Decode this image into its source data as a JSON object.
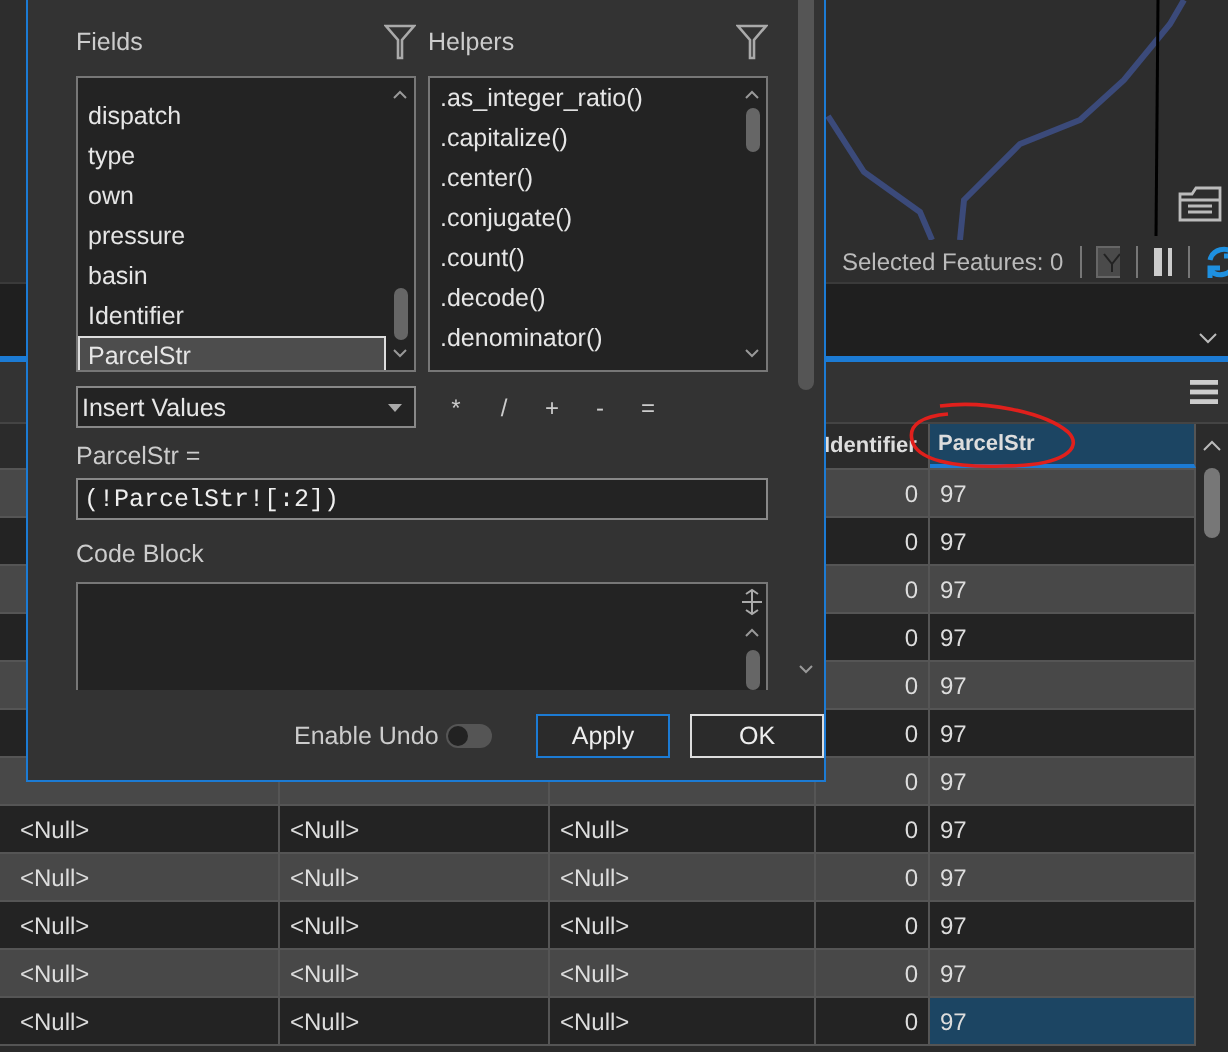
{
  "map": {
    "status_text": "Selected Features: 0"
  },
  "table": {
    "columns": [
      null,
      null,
      null,
      {
        "label": "Identifier",
        "selected": false
      },
      {
        "label": "ParcelStr",
        "selected": true
      }
    ],
    "rows": [
      {
        "cells": [
          null,
          null,
          null,
          "0",
          "97"
        ],
        "selected": false
      },
      {
        "cells": [
          null,
          null,
          null,
          "0",
          "97"
        ],
        "selected": false
      },
      {
        "cells": [
          null,
          null,
          null,
          "0",
          "97"
        ],
        "selected": false
      },
      {
        "cells": [
          null,
          null,
          null,
          "0",
          "97"
        ],
        "selected": false
      },
      {
        "cells": [
          null,
          null,
          null,
          "0",
          "97"
        ],
        "selected": false
      },
      {
        "cells": [
          null,
          null,
          null,
          "0",
          "97"
        ],
        "selected": false
      },
      {
        "cells": [
          null,
          null,
          null,
          "0",
          "97"
        ],
        "selected": false
      },
      {
        "cells": [
          "<Null>",
          "<Null>",
          "<Null>",
          "0",
          "97"
        ],
        "selected": false
      },
      {
        "cells": [
          "<Null>",
          "<Null>",
          "<Null>",
          "0",
          "97"
        ],
        "selected": false
      },
      {
        "cells": [
          "<Null>",
          "<Null>",
          "<Null>",
          "0",
          "97"
        ],
        "selected": false
      },
      {
        "cells": [
          "<Null>",
          "<Null>",
          "<Null>",
          "0",
          "97"
        ],
        "selected": false
      },
      {
        "cells": [
          "<Null>",
          "<Null>",
          "<Null>",
          "0",
          "97"
        ],
        "selected": true
      }
    ]
  },
  "dialog": {
    "fields_label": "Fields",
    "helpers_label": "Helpers",
    "fields": [
      {
        "label": "dispatch",
        "selected": false
      },
      {
        "label": "type",
        "selected": false
      },
      {
        "label": "own",
        "selected": false
      },
      {
        "label": "pressure",
        "selected": false
      },
      {
        "label": "basin",
        "selected": false
      },
      {
        "label": "Identifier",
        "selected": false
      },
      {
        "label": "ParcelStr",
        "selected": true
      }
    ],
    "helpers": [
      ".as_integer_ratio()",
      ".capitalize()",
      ".center()",
      ".conjugate()",
      ".count()",
      ".decode()",
      ".denominator()"
    ],
    "insert_dropdown": "Insert Values",
    "operators": [
      "*",
      "/",
      "+",
      "-",
      "="
    ],
    "expression_label": "ParcelStr =",
    "expression": "(!ParcelStr![:2])",
    "code_block_label": "Code Block",
    "enable_undo": {
      "label": "Enable Undo",
      "on": false
    },
    "buttons": [
      {
        "label": "Apply",
        "focused": true
      },
      {
        "label": "OK",
        "focused": false
      }
    ]
  }
}
